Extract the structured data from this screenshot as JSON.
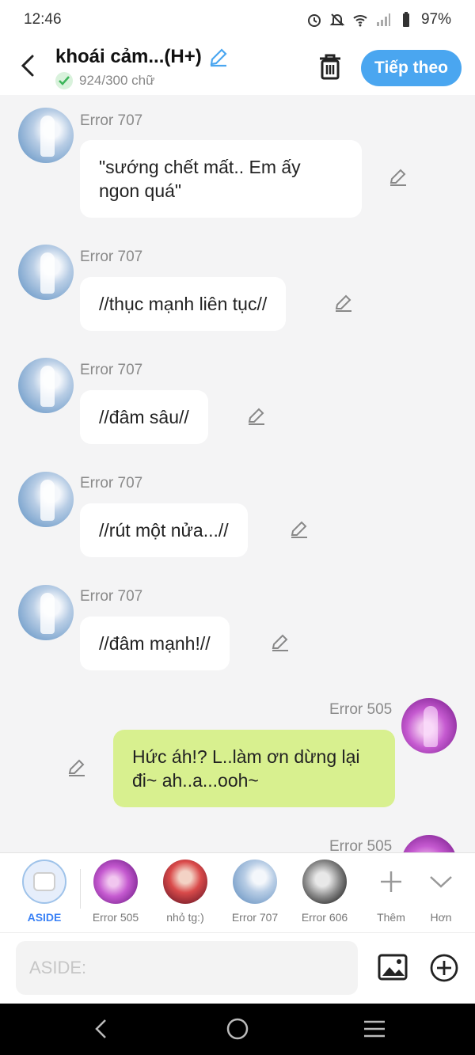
{
  "status_bar": {
    "time": "12:46",
    "battery": "97%"
  },
  "header": {
    "title": "khoái cảm...(H+)",
    "word_count": "924/300 chữ",
    "next_label": "Tiếp theo"
  },
  "messages": [
    {
      "sender": "Error 707",
      "text": "\"sướng chết mất.. Em ấy ngon quá\""
    },
    {
      "sender": "Error 707",
      "text": "//thục mạnh liên tục//"
    },
    {
      "sender": "Error 707",
      "text": "//đâm sâu//"
    },
    {
      "sender": "Error 707",
      "text": "//rút một nửa...//"
    },
    {
      "sender": "Error 707",
      "text": "//đâm mạnh!//"
    },
    {
      "sender": "Error 505",
      "text": "Hức áh!? L..làm ơn dừng lại đi~ ah..a...ooh~"
    },
    {
      "sender": "Error 505"
    }
  ],
  "toolbar": {
    "items": [
      {
        "label": "ASIDE"
      },
      {
        "label": "Error 505"
      },
      {
        "label": "nhỏ tg:)"
      },
      {
        "label": "Error 707"
      },
      {
        "label": "Error 606"
      },
      {
        "label": "Thêm"
      },
      {
        "label": "Hơn"
      }
    ]
  },
  "input": {
    "placeholder": "ASIDE:"
  },
  "colors": {
    "accent": "#4aa6f0",
    "my_bubble": "#d8f08f",
    "check_green": "#3cb55a"
  },
  "icons": [
    "back-icon",
    "edit-icon",
    "check-icon",
    "trash-icon",
    "image-icon",
    "plus-circle-icon",
    "plus-icon",
    "chevron-down-icon",
    "nav-back-icon",
    "nav-home-icon",
    "nav-recents-icon"
  ]
}
